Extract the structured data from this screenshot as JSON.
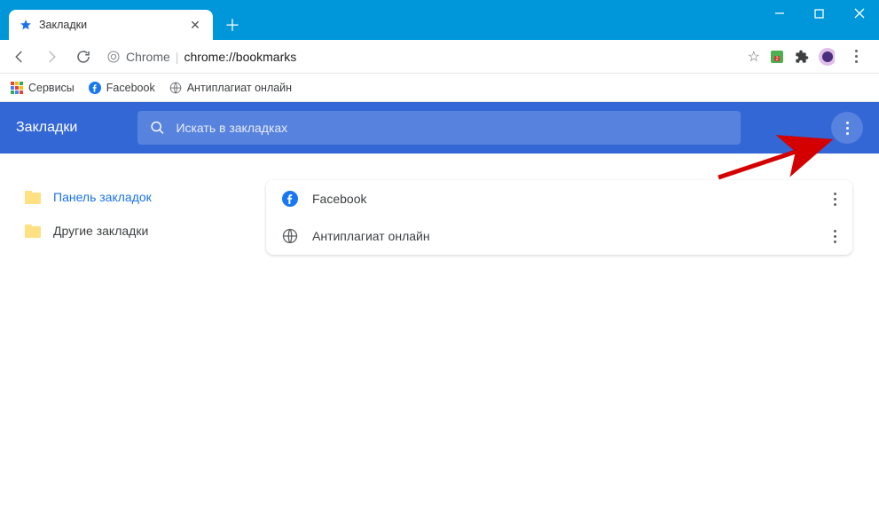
{
  "tab": {
    "title": "Закладки"
  },
  "url": {
    "scheme": "Chrome",
    "path": "chrome://bookmarks"
  },
  "bookmarksBar": {
    "apps": "Сервисы",
    "items": [
      "Facebook",
      "Антиплагиат онлайн"
    ]
  },
  "manager": {
    "title": "Закладки",
    "searchPlaceholder": "Искать в закладках"
  },
  "sidebar": {
    "items": [
      {
        "label": "Панель закладок"
      },
      {
        "label": "Другие закладки"
      }
    ]
  },
  "list": {
    "rows": [
      {
        "label": "Facebook"
      },
      {
        "label": "Антиплагиат онлайн"
      }
    ]
  }
}
